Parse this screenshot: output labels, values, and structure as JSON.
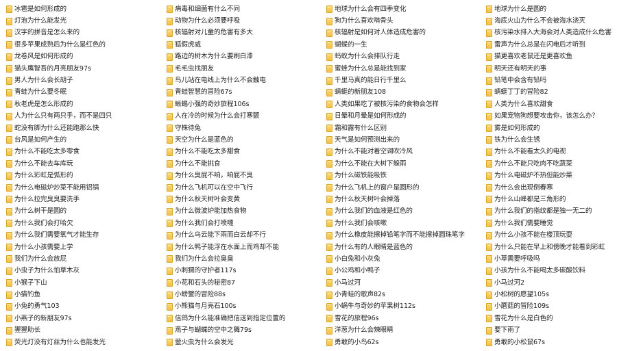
{
  "colors": {
    "folder_fill": "#f4c247",
    "folder_border": "#d9a52b",
    "text": "#222222",
    "background": "#ffffff"
  },
  "icon": "folder-icon",
  "columns": [
    {
      "items": [
        "冰雹是如何形成的",
        "灯泡为什么能发光",
        "汉字的拼音是怎么来的",
        "很多苹果成熟后为什么是红色的",
        "龙卷风是如何形成的",
        "猫头鹰智吾的月亮朋友97s",
        "男人为什么会长胡子",
        "青蛙为什么要冬眠",
        "秋老虎是怎么形成的",
        "人为什么只有两只手，而不是四只",
        "蛇没有脚为什么还能跑那么快",
        "台风是如何产生的",
        "为什么不能吃太多零食",
        "为什么不能去车库玩",
        "为什么彩虹是弧形的",
        "为什么电磁炉炒菜不能用铝锅",
        "为什么拉完臭臭要洗手",
        "为什么树干是圆的",
        "为什么我们会打哈欠",
        "为什么我们需要氧气才能生存",
        "为什么小孩需要上学",
        "我们为什么会放屁",
        "小虫子为什么怕草木灰",
        "小猴子下山",
        "小猫钓鱼",
        "小兔的勇气103",
        "小燕子的新朋友97s",
        "猩猩助长",
        "荧光灯没有灯丝为什么也能发光"
      ]
    },
    {
      "items": [
        "病毒和细菌有什么不同",
        "动物为什么必须要呼吸",
        "核辐射对儿童的危害有多大",
        "狐假虎威",
        "路边的树木为什么要刷白漆",
        "毛毛虫找朋友",
        "鸟儿站在电线上为什么不会触电",
        "青蛙智慧的冒险67s",
        "蜥蜴小强的奇妙旅程106s",
        "人在冷的时候为什么会打寒颤",
        "守株待兔",
        "天空为什么是蓝色的",
        "为什么不能吃太多甜食",
        "为什么不能挑食",
        "为什么臭屁不响，响屁不臭",
        "为什么飞机可以在空中飞行",
        "为什么秋天树叶会变黄",
        "为什么微波炉能加热食物",
        "为什么我们会打喷嚏",
        "为什么乌云能下雨而白云却不行",
        "为什么鸭子能浮在水面上而鸡却不能",
        "我们为什么会拉臭臭",
        "小刺猬的守护者117s",
        "小花和石头的秘密87",
        "小螃蟹的冒险88s",
        "小熊猫与月亮石100s",
        "信鸽为什么能准确把信送到指定位置的",
        "燕子与蝴蝶的空中之舞79s",
        "萤火虫为什么会发光"
      ]
    },
    {
      "items": [
        "地球为什么会有四季变化",
        "狗为什么喜欢啃骨头",
        "核辐射是如何对人体造成危害的",
        "蝴蝶的一生",
        "蚂蚁为什么会排队行走",
        "蜜蜂为什么总是能找到家",
        "千里马真的能日行千里么",
        "蜻蜓的新朋友108",
        "人类如果吃了被核污染的食物会怎样",
        "日晕和月晕是如何形成的",
        "霜和露有什么区别",
        "天气是如何预测出来的",
        "为什么不能对着空调吹冷风",
        "为什么不能在大树下躲雨",
        "为什么磁铁能吸铁",
        "为什么飞机上的窗户是圆形的",
        "为什么秋天树叶会掉落",
        "为什么我们的血液是红色的",
        "为什么我们会咳嗽",
        "为什么橡皮能擦掉铅笔字而不能擦掉圆珠笔字",
        "为什么有的人眼睛是蓝色的",
        "小白兔和小灰兔",
        "小公鸡和小鸭子",
        "小马过河",
        "小青蛙的歌声82s",
        "小蜗牛与奇妙的苹果树112s",
        "雪花的旅程96s",
        "洋葱为什么会辣眼睛",
        "勇敢的小鸟62s"
      ]
    },
    {
      "items": [
        "地球为什么是圆的",
        "海底火山为什么不会被海水浇灭",
        "核污染水排入大海会对人类造成什么危害",
        "雷声为什么总是在闪电后才听到",
        "猫更喜欢老鼠还是更喜欢鱼",
        "明天还有明天的事",
        "铅笔中会含有铅吗",
        "蜻蜓丁丁的冒险82",
        "人类为什么喜欢甜食",
        "如果宠物狗想要攻击你，该怎么办？",
        "雾是如何形成的",
        "铁为什么会生锈",
        "为什么不能看太久的电视",
        "为什么不能只吃肉不吃蔬菜",
        "为什么电磁炉不热但能炒菜",
        "为什么会出现倒春寒",
        "为什么山峰都是三角形的",
        "为什么我们的指纹都是独一无二的",
        "为什么我们需要睡觉",
        "为什么小孩不能在楼顶玩耍",
        "为什么只能在早上和傍晚才能看到彩虹",
        "小草需要呼吸吗",
        "小孩为什么不能喝太多碳酸饮料",
        "小马过河2",
        "小松树的愿望105s",
        "小蘑菇的冒险109s",
        "雪花为什么是白色的",
        "要下雨了",
        "勇敢的小松鼠67s"
      ]
    }
  ]
}
